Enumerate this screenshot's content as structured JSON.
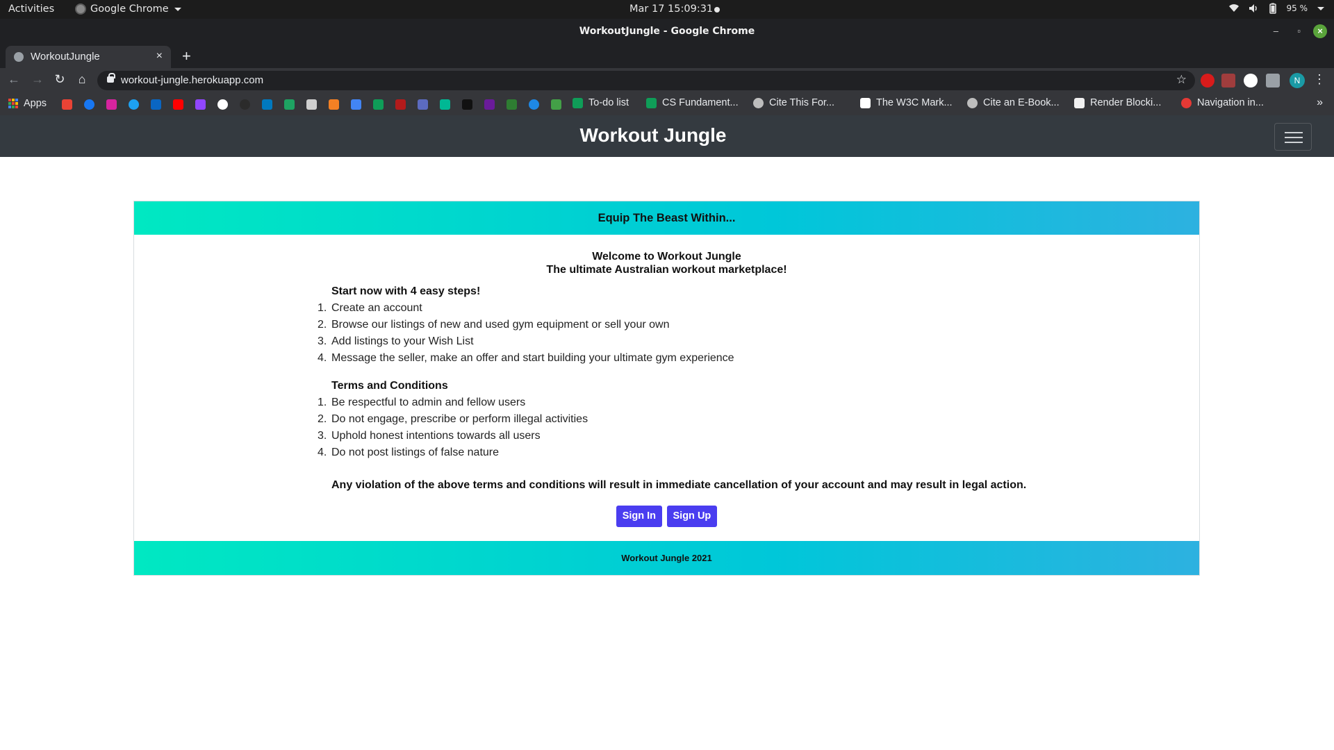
{
  "os_bar": {
    "activities": "Activities",
    "app_name": "Google Chrome",
    "clock": "Mar 17  15:09:31",
    "battery": "95 %"
  },
  "window": {
    "title": "WorkoutJungle - Google Chrome"
  },
  "browser": {
    "tab_title": "WorkoutJungle",
    "url": "workout-jungle.herokuapp.com",
    "profile_initial": "N"
  },
  "bookmarks": {
    "apps_label": "Apps",
    "labeled": [
      "To-do list",
      "CS Fundament...",
      "Cite This For...",
      "The W3C Mark...",
      "Cite an E-Book...",
      "Render Blocki...",
      "Navigation in..."
    ],
    "more": "»"
  },
  "site": {
    "brand": "Workout Jungle"
  },
  "card": {
    "header": "Equip The Beast Within...",
    "welcome_line1": "Welcome to Workout Jungle",
    "welcome_line2": "The ultimate Australian workout marketplace!",
    "steps_title": "Start now with 4 easy steps!",
    "steps": [
      "Create an account",
      "Browse our listings of new and used gym equipment or sell your own",
      "Add listings to your Wish List",
      "Message the seller, make an offer and start building your ultimate gym experience"
    ],
    "terms_title": "Terms and Conditions",
    "terms": [
      "Be respectful to admin and fellow users",
      "Do not engage, prescribe or perform illegal activities",
      "Uphold honest intentions towards all users",
      "Do not post listings of false nature"
    ],
    "warning": "Any violation of the above terms and conditions will result in immediate cancellation of your account and may result in legal action.",
    "sign_in": "Sign In",
    "sign_up": "Sign Up",
    "footer": "Workout Jungle 2021"
  }
}
